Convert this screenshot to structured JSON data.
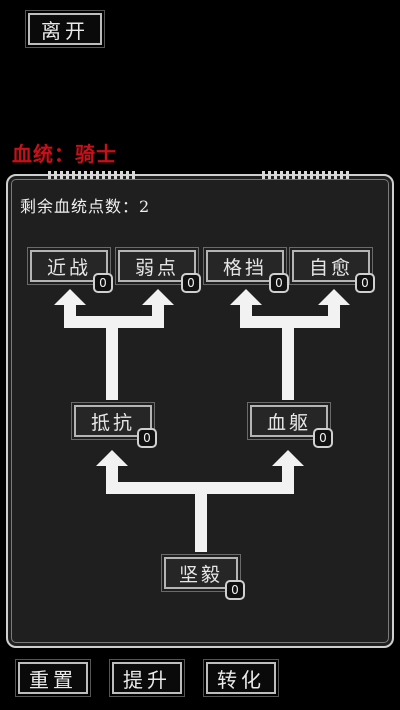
{
  "header": {
    "leave_label": "离开"
  },
  "title": "血统：骑士",
  "remaining_points": "剩余血统点数：2",
  "skills": {
    "melee": {
      "label": "近战",
      "level": "0"
    },
    "weakness": {
      "label": "弱点",
      "level": "0"
    },
    "parry": {
      "label": "格挡",
      "level": "0"
    },
    "heal": {
      "label": "自愈",
      "level": "0"
    },
    "resist": {
      "label": "抵抗",
      "level": "0"
    },
    "blood_body": {
      "label": "血躯",
      "level": "0"
    },
    "tenacity": {
      "label": "坚毅",
      "level": "0"
    }
  },
  "footer": {
    "reset_label": "重置",
    "upgrade_label": "提升",
    "convert_label": "转化"
  },
  "colors": {
    "title": "#c8101a",
    "panel": "#1f1f1f",
    "arrows": "#f2f2f2"
  }
}
